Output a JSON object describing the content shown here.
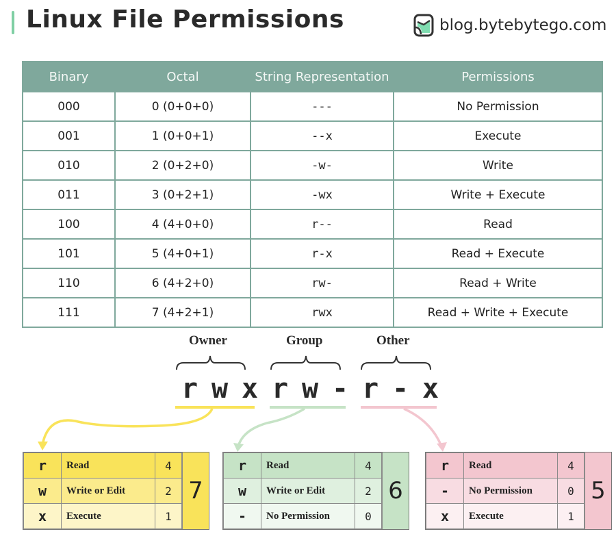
{
  "header": {
    "title": "Linux File Permissions",
    "brand": "blog.bytebytego.com",
    "accent_color": "#7fcfa4"
  },
  "table": {
    "columns": [
      "Binary",
      "Octal",
      "String Representation",
      "Permissions"
    ],
    "rows": [
      {
        "binary": "000",
        "octal": "0 (0+0+0)",
        "string": "---",
        "permissions": "No Permission"
      },
      {
        "binary": "001",
        "octal": "1 (0+0+1)",
        "string": "--x",
        "permissions": "Execute"
      },
      {
        "binary": "010",
        "octal": "2 (0+2+0)",
        "string": "-w-",
        "permissions": "Write"
      },
      {
        "binary": "011",
        "octal": "3 (0+2+1)",
        "string": "-wx",
        "permissions": "Write + Execute"
      },
      {
        "binary": "100",
        "octal": "4 (4+0+0)",
        "string": "r--",
        "permissions": "Read"
      },
      {
        "binary": "101",
        "octal": "5 (4+0+1)",
        "string": "r-x",
        "permissions": "Read + Execute"
      },
      {
        "binary": "110",
        "octal": "6 (4+2+0)",
        "string": "rw-",
        "permissions": "Read + Write"
      },
      {
        "binary": "111",
        "octal": "7 (4+2+1)",
        "string": "rwx",
        "permissions": "Read + Write + Execute"
      }
    ],
    "header_color": "#7fa89c"
  },
  "example": {
    "groups": [
      {
        "label": "Owner",
        "chars": [
          "r",
          "w",
          "x"
        ],
        "color": "#f9e35a",
        "rows": [
          {
            "symbol": "r",
            "label": "Read",
            "value": "4"
          },
          {
            "symbol": "w",
            "label": "Write or Edit",
            "value": "2"
          },
          {
            "symbol": "x",
            "label": "Execute",
            "value": "1"
          }
        ],
        "total": "7"
      },
      {
        "label": "Group",
        "chars": [
          "r",
          "w",
          "-"
        ],
        "color": "#c6e3c6",
        "rows": [
          {
            "symbol": "r",
            "label": "Read",
            "value": "4"
          },
          {
            "symbol": "w",
            "label": "Write or Edit",
            "value": "2"
          },
          {
            "symbol": "-",
            "label": "No Permission",
            "value": "0"
          }
        ],
        "total": "6"
      },
      {
        "label": "Other",
        "chars": [
          "r",
          "-",
          "x"
        ],
        "color": "#f3c6cf",
        "rows": [
          {
            "symbol": "r",
            "label": "Read",
            "value": "4"
          },
          {
            "symbol": "-",
            "label": "No Permission",
            "value": "0"
          },
          {
            "symbol": "x",
            "label": "Execute",
            "value": "1"
          }
        ],
        "total": "5"
      }
    ]
  }
}
